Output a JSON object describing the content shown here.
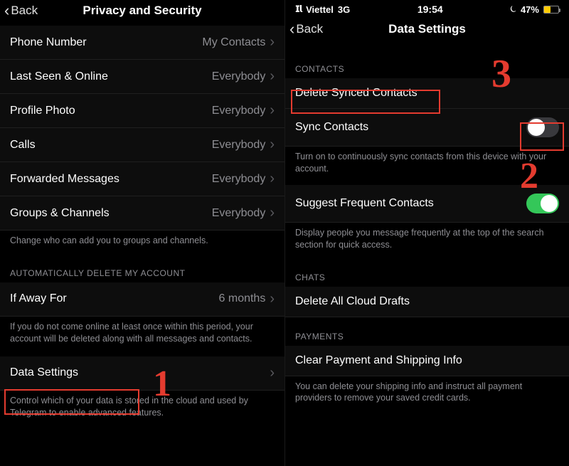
{
  "left": {
    "back_label": "Back",
    "title": "Privacy and Security",
    "privacy_rows": [
      {
        "label": "Phone Number",
        "value": "My Contacts"
      },
      {
        "label": "Last Seen & Online",
        "value": "Everybody"
      },
      {
        "label": "Profile Photo",
        "value": "Everybody"
      },
      {
        "label": "Calls",
        "value": "Everybody"
      },
      {
        "label": "Forwarded Messages",
        "value": "Everybody"
      },
      {
        "label": "Groups & Channels",
        "value": "Everybody"
      }
    ],
    "privacy_footer": "Change who can add you to groups and channels.",
    "del_section": "AUTOMATICALLY DELETE MY ACCOUNT",
    "if_away_label": "If Away For",
    "if_away_value": "6 months",
    "del_footer": "If you do not come online at least once within this period, your account will be deleted along with all messages and contacts.",
    "data_settings_label": "Data Settings",
    "data_settings_footer": "Control which of your data is stored in the cloud and used by Telegram to enable advanced features."
  },
  "right": {
    "status": {
      "carrier": "Viettel",
      "network": "3G",
      "time": "19:54",
      "battery_pct": "47%"
    },
    "back_label": "Back",
    "title": "Data Settings",
    "contacts_header": "CONTACTS",
    "delete_synced_label": "Delete Synced Contacts",
    "sync_contacts_label": "Sync Contacts",
    "sync_contacts_footer": "Turn on to continuously sync contacts from this device with your account.",
    "suggest_label": "Suggest Frequent Contacts",
    "suggest_footer": "Display people you message frequently at the top of the search section for quick access.",
    "chats_header": "CHATS",
    "delete_drafts_label": "Delete All Cloud Drafts",
    "payments_header": "PAYMENTS",
    "clear_payment_label": "Clear Payment and Shipping Info",
    "clear_payment_footer": "You can delete your shipping info and instruct all payment providers to remove your saved credit cards."
  },
  "annotations": {
    "n1": "1",
    "n2": "2",
    "n3": "3"
  }
}
